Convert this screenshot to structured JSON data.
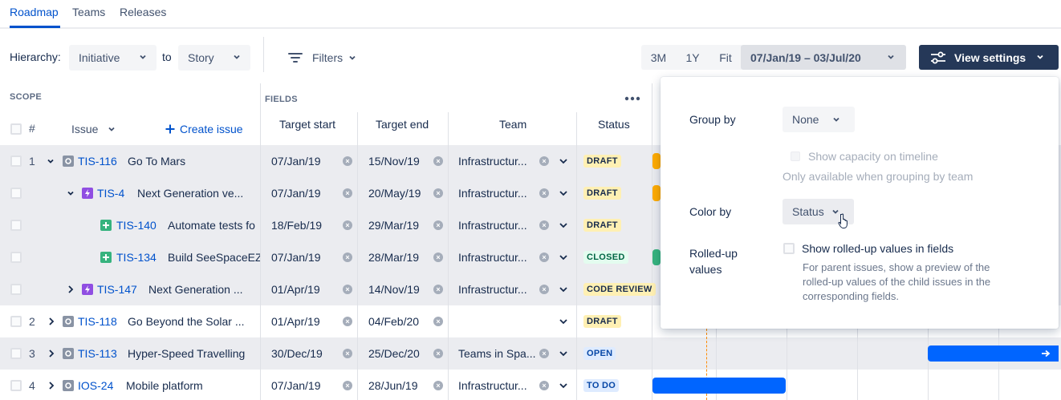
{
  "tabs": [
    {
      "label": "Roadmap",
      "active": true
    },
    {
      "label": "Teams",
      "active": false
    },
    {
      "label": "Releases",
      "active": false
    }
  ],
  "toolbar": {
    "hierarchy_label": "Hierarchy:",
    "hierarchy_from": "Initiative",
    "to_label": "to",
    "hierarchy_to": "Story",
    "filters_label": "Filters",
    "zoom_3m": "3M",
    "zoom_1y": "1Y",
    "zoom_fit": "Fit",
    "date_range": "07/Jan/19 – 03/Jul/20",
    "view_settings_label": "View settings"
  },
  "table": {
    "scope_label": "SCOPE",
    "fields_label": "FIELDS",
    "num_header": "#",
    "issue_header": "Issue",
    "create_issue_label": "Create issue",
    "target_start_header": "Target start",
    "target_end_header": "Target end",
    "team_header": "Team",
    "status_header": "Status",
    "rows": [
      {
        "num": "1",
        "key": "TIS-116",
        "summary": "Go To Mars",
        "start": "07/Jan/19",
        "end": "15/Nov/19",
        "team": "Infrastructur...",
        "status": "DRAFT"
      },
      {
        "num": "",
        "key": "TIS-4",
        "summary": "Next Generation ve...",
        "start": "07/Jan/19",
        "end": "20/May/19",
        "team": "Infrastructur...",
        "status": "DRAFT"
      },
      {
        "num": "",
        "key": "TIS-140",
        "summary": "Automate tests fo",
        "start": "18/Feb/19",
        "end": "29/Mar/19",
        "team": "Infrastructur...",
        "status": "DRAFT"
      },
      {
        "num": "",
        "key": "TIS-134",
        "summary": "Build SeeSpaceEZ",
        "start": "07/Jan/19",
        "end": "28/Mar/19",
        "team": "Infrastructur...",
        "status": "CLOSED"
      },
      {
        "num": "",
        "key": "TIS-147",
        "summary": "Next Generation ...",
        "start": "01/Apr/19",
        "end": "14/Nov/19",
        "team": "Infrastructur...",
        "status": "CODE REVIEW"
      },
      {
        "num": "2",
        "key": "TIS-118",
        "summary": "Go Beyond the Solar ...",
        "start": "01/Apr/19",
        "end": "04/Feb/20",
        "team": "",
        "status": "DRAFT"
      },
      {
        "num": "3",
        "key": "TIS-113",
        "summary": "Hyper-Speed Travelling",
        "start": "30/Dec/19",
        "end": "25/Dec/20",
        "team": "Teams in Spa...",
        "status": "OPEN"
      },
      {
        "num": "4",
        "key": "IOS-24",
        "summary": "Mobile platform",
        "start": "07/Jan/19",
        "end": "28/Jun/19",
        "team": "Infrastructur...",
        "status": "TO DO"
      }
    ]
  },
  "panel": {
    "group_by_label": "Group by",
    "group_by_value": "None",
    "show_capacity_label": "Show capacity on timeline",
    "capacity_note": "Only available when grouping by team",
    "color_by_label": "Color by",
    "color_by_value": "Status",
    "rolled_up_label_1": "Rolled-up",
    "rolled_up_label_2": "values",
    "rolled_up_checkbox_label": "Show rolled-up values in fields",
    "rolled_up_help_1": "For parent issues, show a preview of the",
    "rolled_up_help_2": "rolled-up values of the child issues in the",
    "rolled_up_help_3": "corresponding fields."
  },
  "colors": {
    "primary": "#0052CC",
    "navy": "#253858",
    "draft_bg": "#FFF0B3",
    "closed_bg": "#E3FCEF",
    "open_bg": "#DEEBFF",
    "bar_blue": "#0065FF",
    "bar_orange": "#FFAB00",
    "bar_green": "#36B37E"
  },
  "icons": {
    "initiative": "initiative-icon",
    "epic": "epic-lightning-icon",
    "story": "story-plus-icon"
  }
}
